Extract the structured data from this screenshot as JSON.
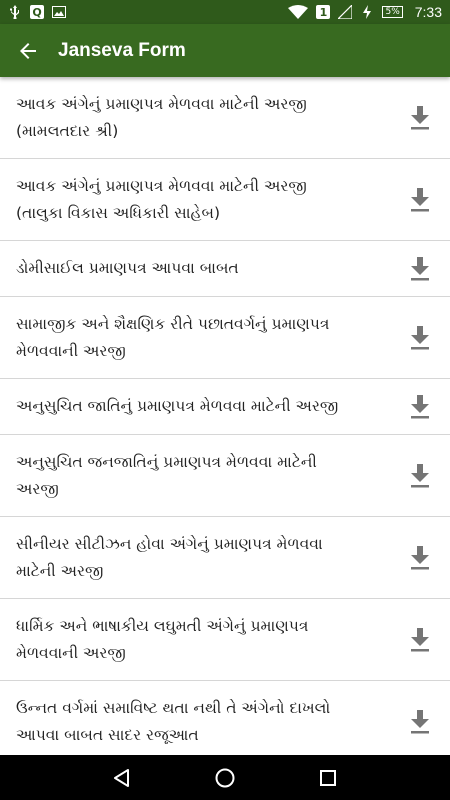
{
  "status_bar": {
    "time": "7:33",
    "battery": "5%",
    "sim": "1",
    "notification_q": "Q"
  },
  "app_bar": {
    "title": "Janseva Form"
  },
  "forms": [
    {
      "line1": "આવક અંગેનું પ્રમાણપત્ર મેળવવા માટેની અરજી",
      "line2": "(મામલતદાર શ્રી)"
    },
    {
      "line1": "આવક અંગેનું પ્રમાણપત્ર મેળવવા માટેની અરજી",
      "line2": "(તાલુકા વિકાસ અધિકારી સાહેબ)"
    },
    {
      "line1": "ડોમીસાઈલ પ્રમાણપત્ર આપવા બાબત",
      "line2": ""
    },
    {
      "line1": "સામાજીક અને શૈક્ષણિક રીતે પછાતવર્ગનું પ્રમાણપત્ર",
      "line2": "મેળવવાની અરજી"
    },
    {
      "line1": "અનુસુચિત જાતિનું પ્રમાણપત્ર મેળવવા માટેની અરજી",
      "line2": ""
    },
    {
      "line1": "અનુસુચિત જનજાતિનું પ્રમાણપત્ર મેળવવા માટેની",
      "line2": "અરજી"
    },
    {
      "line1": "સીનીયર સીટીઝન હોવા અંગેનું પ્રમાણપત્ર મેળવવા",
      "line2": "માટેની અરજી"
    },
    {
      "line1": "ધાર્મિક અને ભાષાકીય લઘુમતી અંગેનું પ્રમાણપત્ર",
      "line2": "મેળવવાની અરજી"
    },
    {
      "line1": "ઉન્નત વર્ગમાં સમાવિષ્ટ થતા નથી તે અંગેનો દાખલો",
      "line2": "આપવા બાબત સાદર રજૂઆત"
    }
  ],
  "colors": {
    "app_bar": "#386a20",
    "status_bar": "#2f5a1b",
    "download_icon": "#757575"
  },
  "icons": {
    "back": "arrow-back-icon",
    "download": "download-icon",
    "nav_back": "triangle-back-icon",
    "nav_home": "circle-home-icon",
    "nav_recents": "square-recents-icon"
  }
}
